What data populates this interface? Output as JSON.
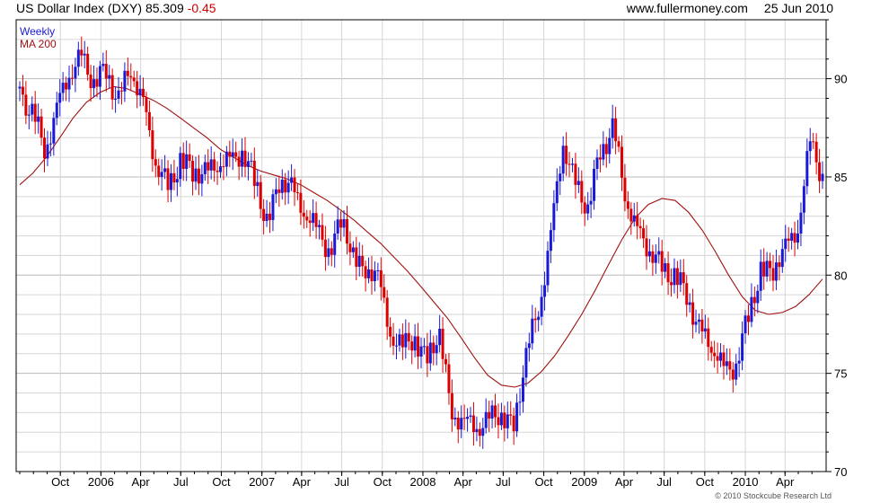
{
  "header": {
    "title": "US Dollar Index (DXY)",
    "last": "85.309",
    "change": "-0.45",
    "website": "www.fullermoney.com",
    "date": "25 Jun 2010"
  },
  "copyright": "© 2010 Stockcube Research Ltd",
  "colors": {
    "up": "#1a1ad6",
    "down": "#dd0000",
    "ma": "#a01010",
    "grid": "#d6d6d6",
    "frame": "#000000"
  },
  "chart_data": {
    "type": "candlestick",
    "frequency": "Weekly",
    "legend": [
      {
        "label": "Weekly",
        "color": "#1a1ad6"
      },
      {
        "label": "MA 200",
        "color": "#a01010"
      }
    ],
    "legend_position": "top-left",
    "grid": true,
    "y_axis_side": "right",
    "ylim": [
      70,
      93
    ],
    "y_ticks": [
      70,
      75,
      80,
      85,
      90
    ],
    "x_ticks": [
      "Oct",
      "2006",
      "Apr",
      "Jul",
      "Oct",
      "2007",
      "Apr",
      "Jul",
      "Oct",
      "2008",
      "Apr",
      "Jul",
      "Oct",
      "2009",
      "Apr",
      "Jul",
      "Oct",
      "2010",
      "Apr"
    ],
    "x_tick_dates": [
      "2005-10-01",
      "2006-01-01",
      "2006-04-01",
      "2006-07-01",
      "2006-10-01",
      "2007-01-01",
      "2007-04-01",
      "2007-07-01",
      "2007-10-01",
      "2008-01-01",
      "2008-04-01",
      "2008-07-01",
      "2008-10-01",
      "2009-01-01",
      "2009-04-01",
      "2009-07-01",
      "2009-10-01",
      "2010-01-01",
      "2010-04-01"
    ],
    "x_range": [
      "2005-07-01",
      "2010-06-25"
    ],
    "close_series": {
      "name": "Weekly",
      "dates": [
        "2005-07-01",
        "2005-07-29",
        "2005-08-26",
        "2005-09-23",
        "2005-10-21",
        "2005-11-18",
        "2005-12-16",
        "2006-01-13",
        "2006-02-10",
        "2006-03-10",
        "2006-04-07",
        "2006-05-05",
        "2006-06-02",
        "2006-06-30",
        "2006-07-28",
        "2006-08-25",
        "2006-09-22",
        "2006-10-20",
        "2006-11-17",
        "2006-12-15",
        "2007-01-12",
        "2007-02-09",
        "2007-03-09",
        "2007-04-06",
        "2007-05-04",
        "2007-06-01",
        "2007-06-29",
        "2007-07-27",
        "2007-08-24",
        "2007-09-21",
        "2007-10-19",
        "2007-11-16",
        "2007-12-14",
        "2008-01-11",
        "2008-02-08",
        "2008-03-07",
        "2008-04-04",
        "2008-05-02",
        "2008-05-30",
        "2008-06-27",
        "2008-07-25",
        "2008-08-22",
        "2008-09-19",
        "2008-10-17",
        "2008-11-14",
        "2008-12-12",
        "2009-01-09",
        "2009-02-06",
        "2009-03-06",
        "2009-04-03",
        "2009-05-01",
        "2009-05-29",
        "2009-06-26",
        "2009-07-24",
        "2009-08-21",
        "2009-09-18",
        "2009-10-16",
        "2009-11-13",
        "2009-12-11",
        "2010-01-08",
        "2010-02-05",
        "2010-03-05",
        "2010-04-02",
        "2010-04-30",
        "2010-05-28",
        "2010-06-25"
      ],
      "values": [
        89.5,
        88.0,
        86.5,
        88.5,
        90.0,
        91.5,
        89.5,
        90.5,
        89.0,
        90.3,
        89.0,
        85.5,
        84.5,
        86.0,
        85.0,
        85.5,
        85.5,
        85.8,
        86.5,
        84.5,
        83.0,
        84.5,
        84.5,
        83.5,
        82.0,
        81.6,
        82.5,
        81.0,
        80.5,
        79.5,
        77.5,
        76.0,
        76.8,
        76.0,
        76.5,
        73.5,
        72.0,
        72.5,
        72.8,
        72.5,
        72.8,
        75.5,
        78.5,
        82.0,
        86.5,
        85.0,
        83.0,
        86.5,
        87.5,
        84.0,
        82.5,
        81.0,
        80.5,
        80.0,
        78.8,
        77.5,
        76.2,
        75.3,
        75.5,
        77.7,
        80.5,
        80.0,
        81.5,
        82.5,
        86.5,
        85.3
      ]
    },
    "ma_series": {
      "name": "MA 200",
      "values": [
        84.6,
        85.2,
        86.0,
        87.0,
        88.0,
        88.8,
        89.3,
        89.6,
        89.5,
        89.2,
        88.9,
        88.5,
        88.0,
        87.5,
        87.0,
        86.4,
        86.0,
        85.6,
        85.3,
        85.1,
        84.9,
        84.6,
        84.2,
        83.8,
        83.3,
        82.8,
        82.2,
        81.6,
        80.9,
        80.2,
        79.4,
        78.6,
        77.8,
        76.8,
        75.8,
        74.9,
        74.4,
        74.3,
        74.5,
        75.1,
        75.9,
        76.9,
        78.0,
        79.2,
        80.5,
        81.8,
        82.9,
        83.6,
        83.9,
        83.8,
        83.2,
        82.3,
        81.2,
        80.0,
        78.9,
        78.2,
        78.0,
        78.1,
        78.4,
        79.0,
        79.8
      ]
    }
  }
}
